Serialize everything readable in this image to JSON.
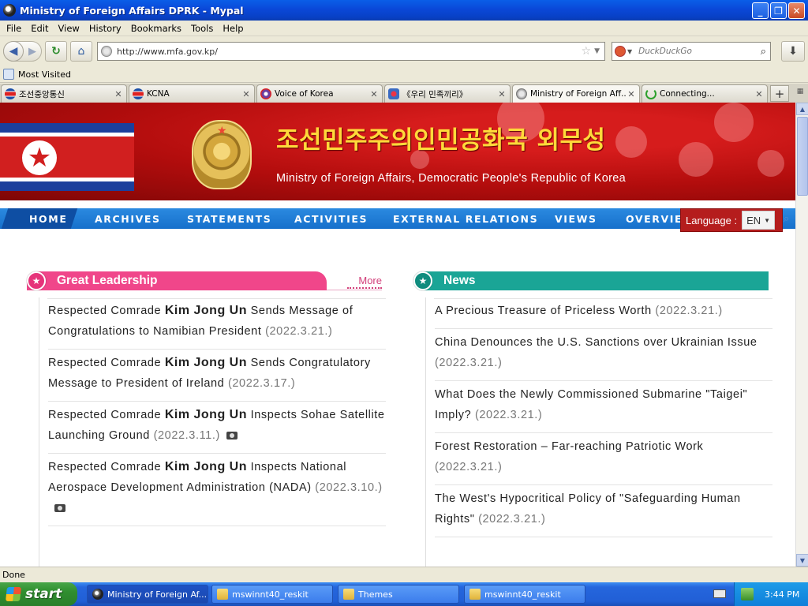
{
  "window": {
    "title": "Ministry of Foreign Affairs DPRK - Mypal"
  },
  "menu": [
    "File",
    "Edit",
    "View",
    "History",
    "Bookmarks",
    "Tools",
    "Help"
  ],
  "nav": {
    "url": "http://www.mfa.gov.kp/",
    "search_placeholder": "DuckDuckGo"
  },
  "bookmarks": {
    "most_visited": "Most Visited"
  },
  "tabs": [
    {
      "label": "조선중앙통신",
      "active": false
    },
    {
      "label": "KCNA",
      "active": false
    },
    {
      "label": "Voice of Korea",
      "active": false
    },
    {
      "label": "《우리 민족끼리》",
      "active": false
    },
    {
      "label": "Ministry of Foreign Aff...",
      "active": true
    },
    {
      "label": "Connecting...",
      "active": false
    }
  ],
  "banner": {
    "korean_title": "조선민주주의인민공화국 외무성",
    "english_title": "Ministry of Foreign Affairs, Democratic People's Republic of Korea"
  },
  "site_nav": [
    "HOME",
    "ARCHIVES",
    "STATEMENTS",
    "ACTIVITIES",
    "EXTERNAL RELATIONS",
    "VIEWS",
    "OVERVIEW"
  ],
  "language": {
    "label": "Language :",
    "value": "EN"
  },
  "great_leadership": {
    "heading": "Great Leadership",
    "more": "More",
    "items": [
      {
        "pre": "Respected Comrade ",
        "name": "Kim Jong Un",
        "post": " Sends Message of Congratulations to Namibian President",
        "date": "(2022.3.21.)",
        "photo": false
      },
      {
        "pre": "Respected Comrade ",
        "name": "Kim Jong Un",
        "post": " Sends Congratulatory Message to President of Ireland",
        "date": "(2022.3.17.)",
        "photo": false
      },
      {
        "pre": "Respected Comrade ",
        "name": "Kim Jong Un",
        "post": " Inspects Sohae Satellite Launching Ground",
        "date": "(2022.3.11.)",
        "photo": true
      },
      {
        "pre": "Respected Comrade ",
        "name": "Kim Jong Un",
        "post": " Inspects National Aerospace Development Administration (NADA)",
        "date": "(2022.3.10.)",
        "photo": true
      }
    ]
  },
  "news": {
    "heading": "News",
    "items": [
      {
        "text": "A Precious Treasure of Priceless Worth",
        "date": "(2022.3.21.)"
      },
      {
        "text": "China Denounces the U.S. Sanctions over Ukrainian Issue",
        "date": "(2022.3.21.)"
      },
      {
        "text": "What Does the Newly Commissioned Submarine \"Taigei\" Imply?",
        "date": "(2022.3.21.)"
      },
      {
        "text": "Forest Restoration – Far-reaching Patriotic Work",
        "date": "(2022.3.21.)"
      },
      {
        "text": "The West's Hypocritical Policy of \"Safeguarding Human Rights\"",
        "date": "(2022.3.21.)"
      }
    ]
  },
  "status": "Done",
  "taskbar": {
    "start": "start",
    "tasks": [
      {
        "label": "Ministry of Foreign Af...",
        "active": true
      },
      {
        "label": "mswinnt40_reskit",
        "active": false
      },
      {
        "label": "Themes",
        "active": false
      },
      {
        "label": "mswinnt40_reskit",
        "active": false
      }
    ],
    "clock": "3:44 PM"
  },
  "colors": {
    "pink_accent": "#f0468a",
    "teal_accent": "#1aa596",
    "nav_blue": "#1670cb",
    "banner_red": "#b30d0d",
    "banner_gold": "#ffd93a"
  }
}
